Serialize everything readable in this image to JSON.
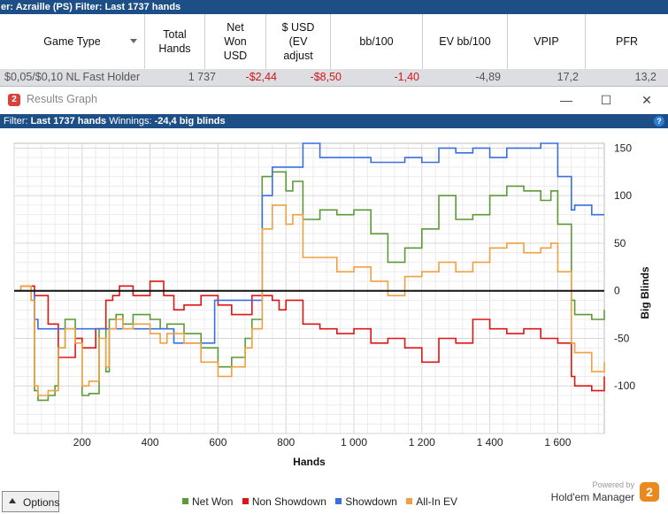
{
  "topbar": {
    "text": "er: Azraille (PS)   Filter: Last 1737 hands"
  },
  "stats_table": {
    "headers": [
      "Game Type",
      "Total Hands",
      "Net Won USD",
      "$ USD (EV adjust",
      "bb/100",
      "EV bb/100",
      "VPIP",
      "PFR"
    ],
    "row": [
      "$0,05/$0,10 NL Fast Holder",
      "1 737",
      "-$2,44",
      "-$8,50",
      "-1,40",
      "-4,89",
      "17,2",
      "13,2"
    ]
  },
  "window": {
    "title": "Results Graph",
    "app_icon": "2",
    "controls": {
      "minimize": "—",
      "maximize": "☐",
      "close": "✕"
    }
  },
  "filter": {
    "label": "Filter:",
    "value": "Last 1737 hands",
    "winnings_label": "Winnings:",
    "winnings_value": "-24,4 big blinds",
    "help": "?"
  },
  "chart_data": {
    "type": "line",
    "xlabel": "Hands",
    "ylabel": "Big Blinds",
    "xlim": [
      0,
      1737
    ],
    "ylim": [
      -150,
      155
    ],
    "x_ticks": [
      200,
      400,
      600,
      800,
      1000,
      1200,
      1400,
      1600
    ],
    "x_tick_labels": [
      "200",
      "400",
      "600",
      "800",
      "1 000",
      "1 200",
      "1 400",
      "1 600"
    ],
    "y_ticks": [
      150,
      100,
      50,
      0,
      -50,
      -100
    ],
    "grid": true,
    "legend_position": "bottom",
    "series": [
      {
        "name": "Net Won",
        "color": "#5b9a34",
        "x": [
          0,
          20,
          50,
          60,
          70,
          100,
          120,
          130,
          150,
          180,
          200,
          220,
          250,
          270,
          280,
          300,
          320,
          350,
          400,
          430,
          450,
          500,
          550,
          600,
          640,
          680,
          700,
          730,
          760,
          800,
          820,
          850,
          900,
          950,
          1000,
          1050,
          1100,
          1150,
          1200,
          1250,
          1300,
          1350,
          1400,
          1450,
          1500,
          1550,
          1580,
          1600,
          1640,
          1650,
          1700,
          1737
        ],
        "y": [
          0,
          5,
          -10,
          -105,
          -115,
          -110,
          -100,
          -60,
          -30,
          -50,
          -110,
          -108,
          -40,
          -85,
          -30,
          -25,
          -35,
          -25,
          -30,
          -40,
          -35,
          -45,
          -60,
          -80,
          -70,
          -50,
          -30,
          120,
          125,
          105,
          115,
          75,
          85,
          80,
          85,
          60,
          30,
          45,
          65,
          100,
          75,
          80,
          100,
          110,
          105,
          95,
          105,
          70,
          -10,
          -25,
          -30,
          -20
        ]
      },
      {
        "name": "Non Showdown",
        "color": "#e01515",
        "x": [
          0,
          20,
          60,
          100,
          130,
          180,
          200,
          240,
          270,
          290,
          310,
          350,
          400,
          440,
          470,
          500,
          550,
          600,
          640,
          680,
          700,
          730,
          760,
          780,
          800,
          850,
          900,
          950,
          1000,
          1050,
          1100,
          1150,
          1200,
          1250,
          1300,
          1350,
          1400,
          1450,
          1500,
          1550,
          1600,
          1640,
          1650,
          1700,
          1720,
          1737
        ],
        "y": [
          0,
          5,
          -5,
          -35,
          -70,
          -50,
          -60,
          -40,
          -10,
          -5,
          5,
          -5,
          10,
          -5,
          -20,
          -15,
          -5,
          -15,
          -25,
          -25,
          -5,
          -5,
          -10,
          -20,
          -10,
          -35,
          -40,
          -45,
          -40,
          -55,
          -50,
          -60,
          -75,
          -50,
          -55,
          -30,
          -40,
          -45,
          -40,
          -50,
          -55,
          -90,
          -100,
          -105,
          -105,
          -90
        ]
      },
      {
        "name": "Showdown",
        "color": "#3a6fe0",
        "x": [
          0,
          60,
          70,
          100,
          130,
          180,
          200,
          240,
          270,
          300,
          350,
          400,
          440,
          470,
          500,
          550,
          590,
          620,
          650,
          680,
          700,
          730,
          760,
          800,
          850,
          900,
          950,
          1000,
          1050,
          1100,
          1150,
          1200,
          1250,
          1300,
          1350,
          1400,
          1450,
          1500,
          1550,
          1600,
          1640,
          1650,
          1700,
          1737
        ],
        "y": [
          0,
          -30,
          -40,
          -40,
          -40,
          -40,
          -40,
          -40,
          -40,
          -40,
          -40,
          -40,
          -40,
          -55,
          -55,
          -55,
          -10,
          -10,
          -10,
          -10,
          -10,
          100,
          130,
          130,
          155,
          140,
          140,
          140,
          135,
          135,
          140,
          135,
          150,
          145,
          150,
          140,
          150,
          150,
          155,
          120,
          85,
          90,
          80,
          80
        ]
      },
      {
        "name": "All-In EV",
        "color": "#f0a040",
        "x": [
          0,
          20,
          50,
          60,
          70,
          100,
          130,
          150,
          180,
          200,
          220,
          250,
          270,
          280,
          300,
          320,
          350,
          400,
          430,
          450,
          500,
          550,
          600,
          640,
          680,
          700,
          730,
          760,
          800,
          820,
          850,
          900,
          950,
          1000,
          1050,
          1100,
          1150,
          1200,
          1250,
          1300,
          1350,
          1400,
          1450,
          1500,
          1550,
          1580,
          1600,
          1640,
          1650,
          1700,
          1737
        ],
        "y": [
          0,
          5,
          -10,
          -100,
          -110,
          -105,
          -60,
          -40,
          -55,
          -100,
          -95,
          -50,
          -80,
          -40,
          -30,
          -40,
          -35,
          -45,
          -55,
          -45,
          -55,
          -75,
          -90,
          -80,
          -60,
          -40,
          65,
          90,
          70,
          80,
          35,
          35,
          20,
          25,
          10,
          -5,
          15,
          20,
          30,
          20,
          30,
          45,
          50,
          40,
          45,
          50,
          20,
          -55,
          -65,
          -85,
          -75
        ]
      }
    ]
  },
  "footer": {
    "options_label": "Options",
    "legend": [
      {
        "label": "Net Won",
        "color": "#5b9a34"
      },
      {
        "label": "Non Showdown",
        "color": "#e01515"
      },
      {
        "label": "Showdown",
        "color": "#3a6fe0"
      },
      {
        "label": "All-In EV",
        "color": "#f0a040"
      }
    ],
    "brand": {
      "powered": "Powered by",
      "name": "Hold'em Manager",
      "logo": "2"
    }
  }
}
